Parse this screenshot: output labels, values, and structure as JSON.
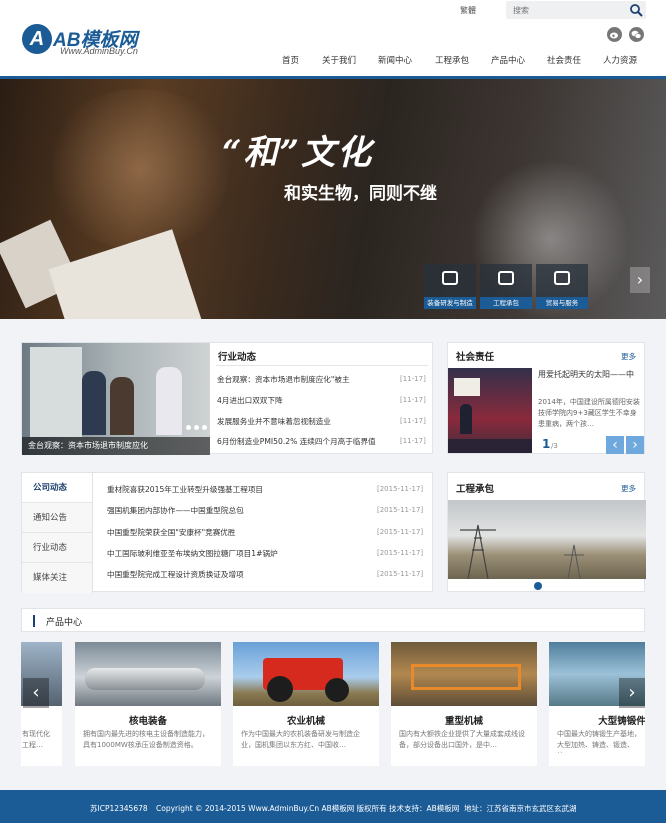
{
  "brand": {
    "title": "AB模板网",
    "subtitle": "Www.AdminBuy.Cn",
    "mark": "A"
  },
  "header": {
    "lang": "繁體",
    "search_placeholder": "搜索"
  },
  "nav": [
    "首页",
    "关于我们",
    "新闻中心",
    "工程承包",
    "产品中心",
    "社会责任",
    "人力资源"
  ],
  "banner": {
    "slogan_main": "“和”文化",
    "slogan_sub": "和实生物，同则不继",
    "buttons": [
      "装备研发与制造",
      "工程承包",
      "贸易与服务"
    ]
  },
  "industry": {
    "title": "行业动态",
    "image_caption": "金台观察：资本市场退市制度应化",
    "items": [
      {
        "text": "金台观察：资本市场退市制度应化\"被主",
        "date": "[11-17]"
      },
      {
        "text": "4月进出口双双下降",
        "date": "[11-17]"
      },
      {
        "text": "发展服务业并不意味着忽视制造业",
        "date": "[11-17]"
      },
      {
        "text": "6月份制造业PMI50.2% 连续四个月高于临界值",
        "date": "[11-17]"
      }
    ]
  },
  "social": {
    "title": "社会责任",
    "more": "更多",
    "headline": "用爱托起明天的太阳——中",
    "summary": "2014年，中国建设所属德阳安装技师学院内9+3藏区学生不幸身患重病，两个孩…",
    "page_current": "1",
    "page_total": "/3"
  },
  "company": {
    "tabs": [
      "公司动态",
      "通知公告",
      "行业动态",
      "媒体关注"
    ],
    "items": [
      {
        "text": "重材院喜获2015年工业转型升级强基工程项目",
        "date": "[2015-11-17]"
      },
      {
        "text": "强国机集团内部协作——中国重型院总包",
        "date": "[2015-11-17]"
      },
      {
        "text": "中国重型院荣获全国\"安康杯\"竞赛优胜",
        "date": "[2015-11-17]"
      },
      {
        "text": "中工国际玻利维亚圣布埃纳文图拉糖厂项目1#锅炉",
        "date": "[2015-11-17]"
      },
      {
        "text": "中国重型院完成工程设计资质换证及增项",
        "date": "[2015-11-17]"
      }
    ]
  },
  "engineering": {
    "title": "工程承包",
    "more": "更多"
  },
  "products": {
    "title": "产品中心",
    "cards": [
      {
        "name": "",
        "desc": "有现代化工程…"
      },
      {
        "name": "核电装备",
        "desc": "拥有国内最先进的核电主设备制造能力，具有1000MW核承压设备制造资格。"
      },
      {
        "name": "农业机械",
        "desc": "作为中国最大的农机装备研发与制造企业，国机集团以东方红、中国收…"
      },
      {
        "name": "重型机械",
        "desc": "国内有大额铁企业提供了大量成套成线设备，部分设备出口国外，是中…"
      },
      {
        "name": "大型铸锻件",
        "desc": "中国最大的铸锻生产基地，大型加热、铸造、锻造、热…"
      }
    ]
  },
  "footer": {
    "icp": "苏ICP12345678",
    "copyright": "Copyright © 2014-2015 Www.AdminBuy.Cn AB模板网 版权所有 技术支持：AB模板网",
    "address": "地址：江苏省南京市玄武区玄武湖"
  },
  "colors": {
    "primary": "#1b5b96",
    "background": "#f1f3f6"
  }
}
